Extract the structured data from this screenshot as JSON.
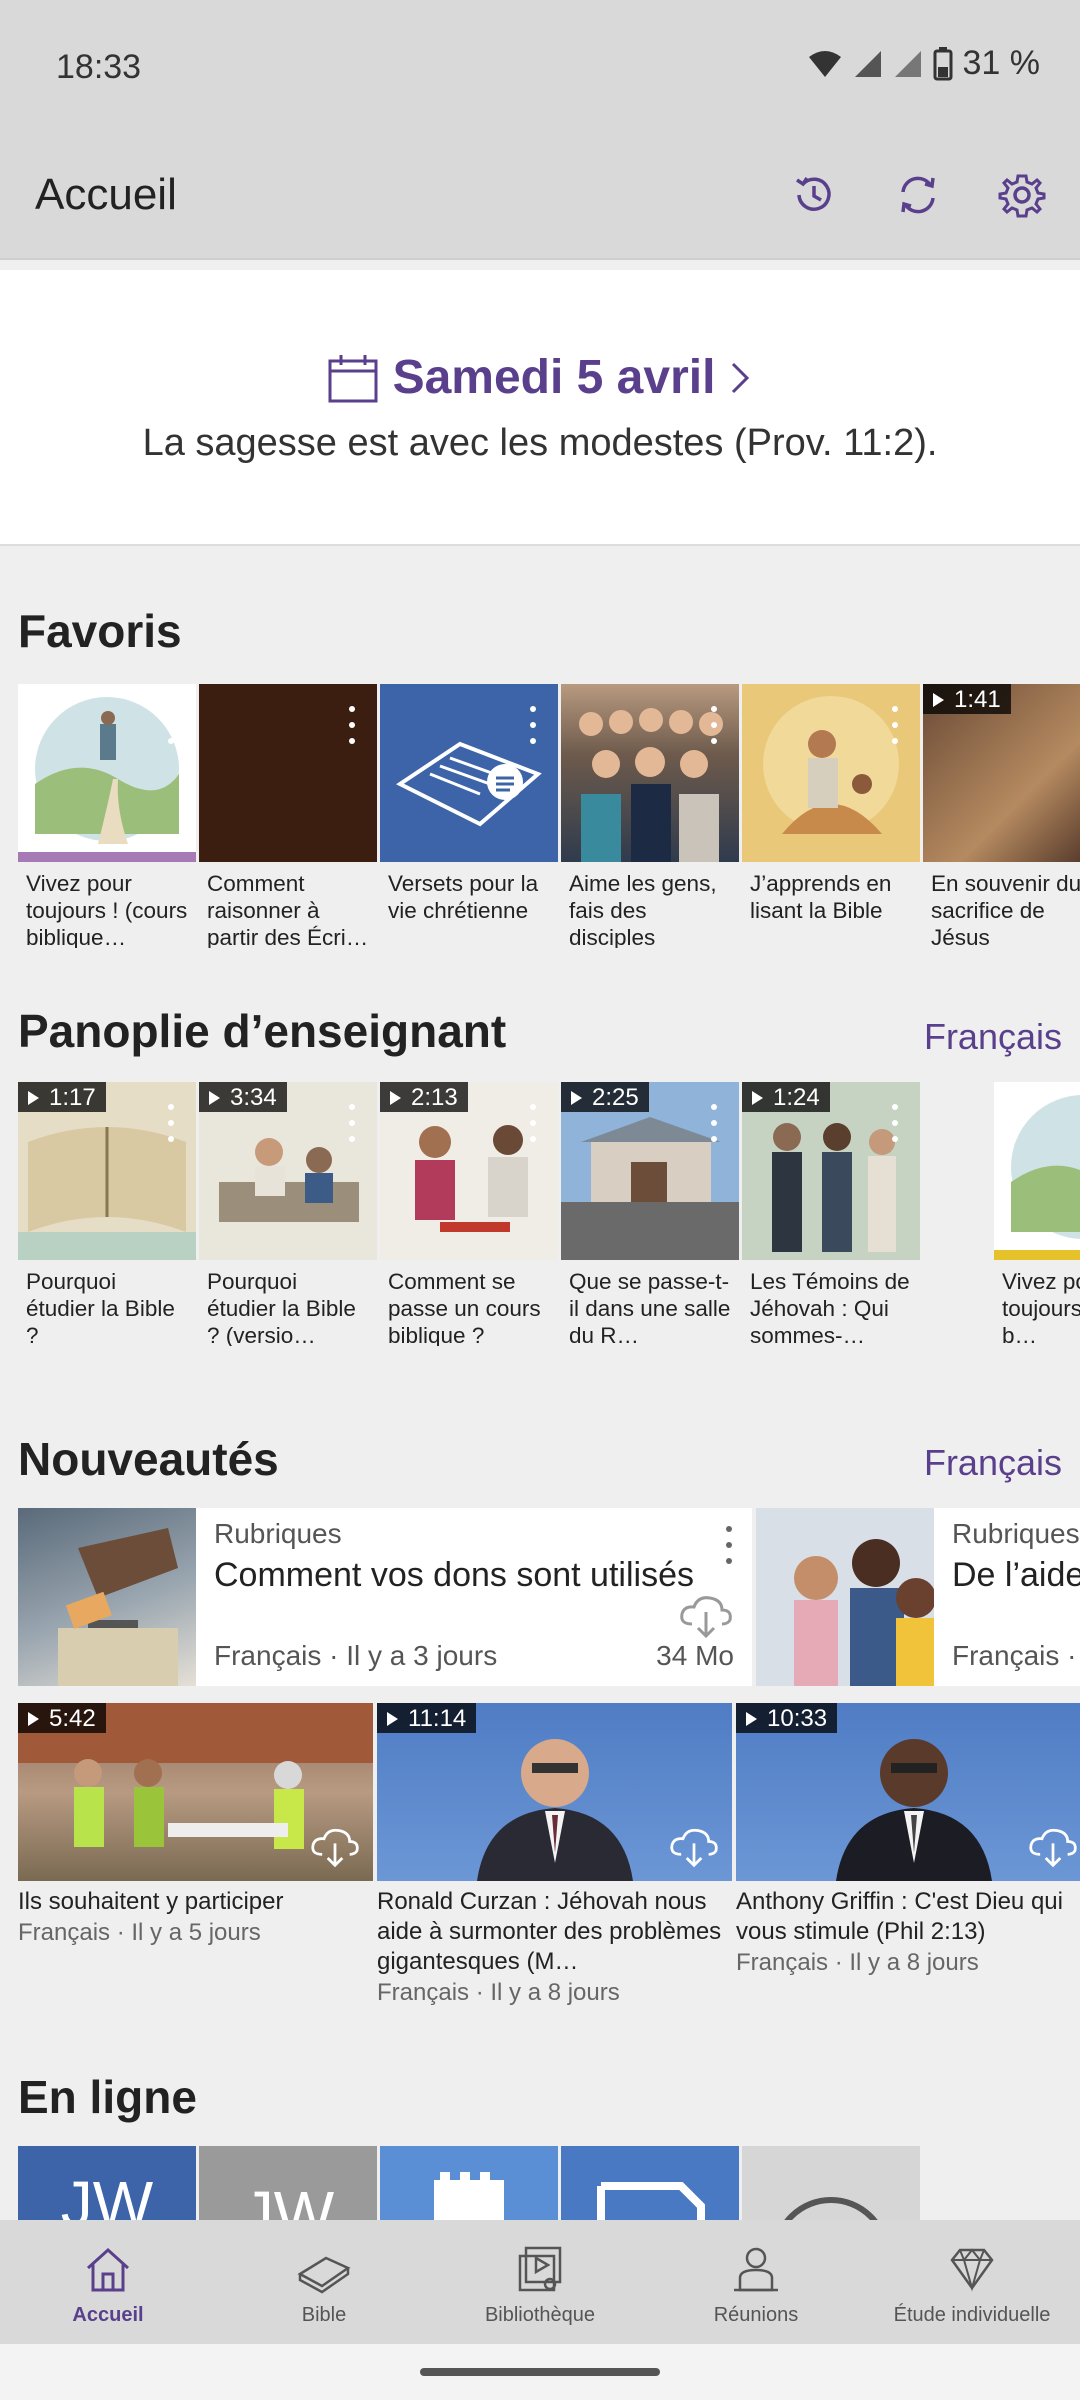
{
  "status": {
    "time": "18:33",
    "battery": "31 %"
  },
  "appbar": {
    "title": "Accueil",
    "icons": [
      "history-icon",
      "sync-icon",
      "settings-icon"
    ]
  },
  "daily_text": {
    "date": "Samedi 5 avril",
    "verse": "La sagesse est avec les modestes (Prov. 11:2)."
  },
  "favorites": {
    "title": "Favoris",
    "items": [
      {
        "label": "Vivez pour toujours ! (cours biblique…"
      },
      {
        "label": "Comment raisonner à partir des Écri…"
      },
      {
        "label": "Versets pour la vie chrétienne"
      },
      {
        "label": "Aime les gens, fais des disciples"
      },
      {
        "label": "J’apprends en lisant la Bible"
      },
      {
        "label": "En souvenir du sacrifice de Jésus",
        "duration": "1:41"
      }
    ]
  },
  "teaching": {
    "title": "Panoplie d’enseignant",
    "language": "Français",
    "items": [
      {
        "label": "Pourquoi étudier la Bible ?",
        "duration": "1:17"
      },
      {
        "label": "Pourquoi étudier la Bible ? (versio…",
        "duration": "3:34"
      },
      {
        "label": "Comment se passe un cours biblique ?",
        "duration": "2:13"
      },
      {
        "label": "Que se passe-t-il dans une salle du R…",
        "duration": "2:25"
      },
      {
        "label": "Les Témoins de Jéhovah : Qui sommes-…",
        "duration": "1:24"
      },
      {
        "label": "Vivez pour toujours ! (cours b…"
      }
    ]
  },
  "news": {
    "title": "Nouveautés",
    "language": "Français",
    "featured": [
      {
        "category": "Rubriques",
        "title": "Comment vos dons sont utilisés",
        "meta": "Français · Il y a 3 jours",
        "size": "34 Mo"
      },
      {
        "category": "Rubriques",
        "title": "De l’aide aux familles",
        "meta": "Français ·"
      }
    ],
    "videos": [
      {
        "duration": "5:42",
        "title": "Ils souhaitent y participer",
        "meta": "Français · Il y a 5 jours"
      },
      {
        "duration": "11:14",
        "title": "Ronald Curzan : Jéhovah nous aide à surmonter des problèmes gigantesques (M…",
        "meta": "Français · Il y a 8 jours"
      },
      {
        "duration": "10:33",
        "title": "Anthony Griffin : C'est Dieu qui vous stimule (Phil 2:13)",
        "meta": "Français · Il y a 8 jours"
      }
    ]
  },
  "online": {
    "title": "En ligne"
  },
  "bottom_nav": [
    {
      "label": "Accueil",
      "icon": "home-icon",
      "active": true
    },
    {
      "label": "Bible",
      "icon": "bible-icon"
    },
    {
      "label": "Bibliothèque",
      "icon": "library-icon"
    },
    {
      "label": "Réunions",
      "icon": "meetings-icon"
    },
    {
      "label": "Étude individuelle",
      "icon": "study-icon"
    }
  ],
  "colors": {
    "accent": "#5a3f8c",
    "bar": "#d9d9d9"
  }
}
